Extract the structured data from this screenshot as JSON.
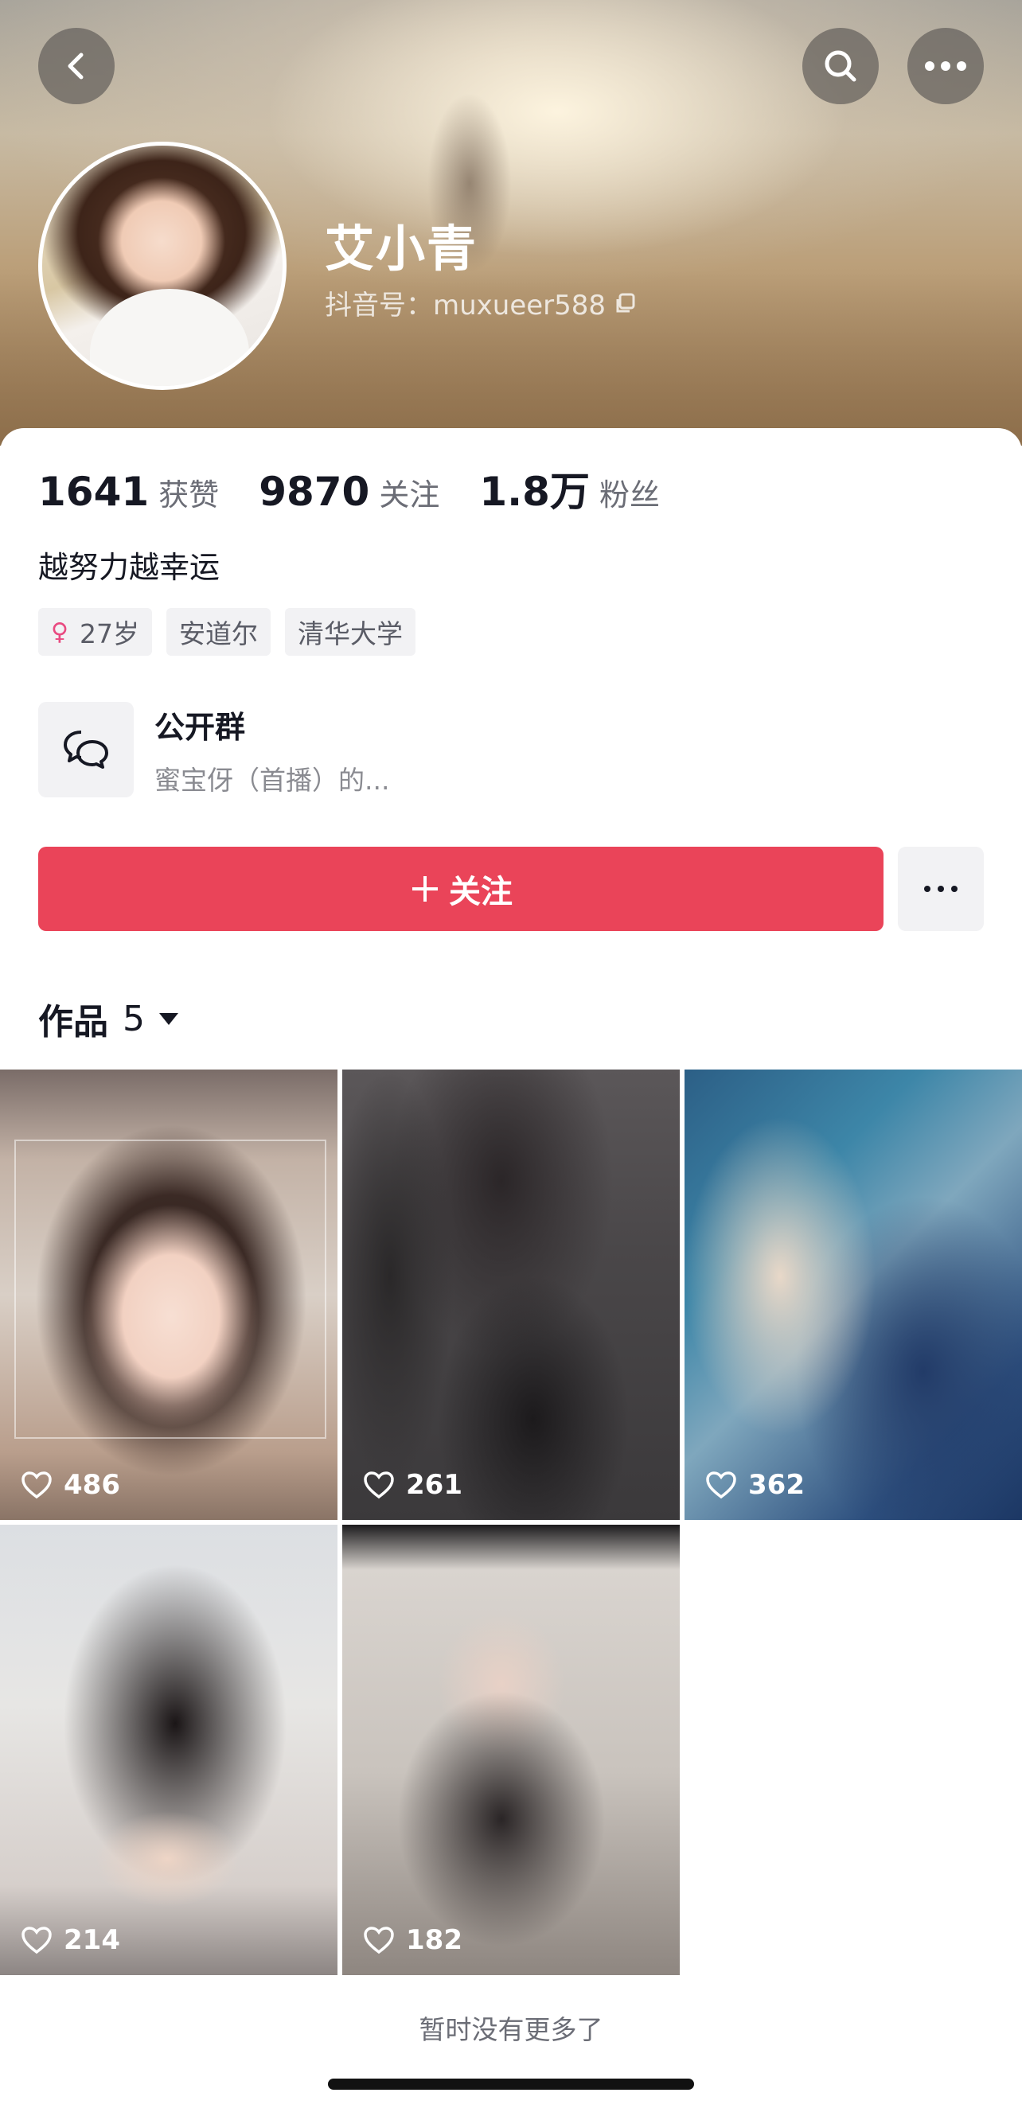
{
  "header": {
    "name": "艾小青",
    "douyin_id": "抖音号：muxueer588"
  },
  "stats": [
    {
      "num": "1641",
      "label": "获赞"
    },
    {
      "num": "9870",
      "label": "关注"
    },
    {
      "num": "1.8万",
      "label": "粉丝"
    }
  ],
  "bio": "越努力越幸运",
  "tags": {
    "age": "27岁",
    "location": "安道尔",
    "school": "清华大学"
  },
  "group": {
    "title": "公开群",
    "subtitle": "蜜宝伢（首播）的..."
  },
  "actions": {
    "follow_label": "关注"
  },
  "works": {
    "label": "作品",
    "count": "5",
    "items": [
      {
        "likes": "486"
      },
      {
        "likes": "261"
      },
      {
        "likes": "362"
      },
      {
        "likes": "214"
      },
      {
        "likes": "182"
      }
    ]
  },
  "footer": {
    "no_more": "暂时没有更多了"
  },
  "colors": {
    "accent": "#ea4459",
    "female_icon": "#e94a80"
  },
  "icons": [
    "back-icon",
    "search-icon",
    "more-icon",
    "copy-icon",
    "female-icon",
    "group-chat-icon",
    "plus-icon",
    "ellipsis-icon",
    "caret-down-icon",
    "heart-icon"
  ]
}
